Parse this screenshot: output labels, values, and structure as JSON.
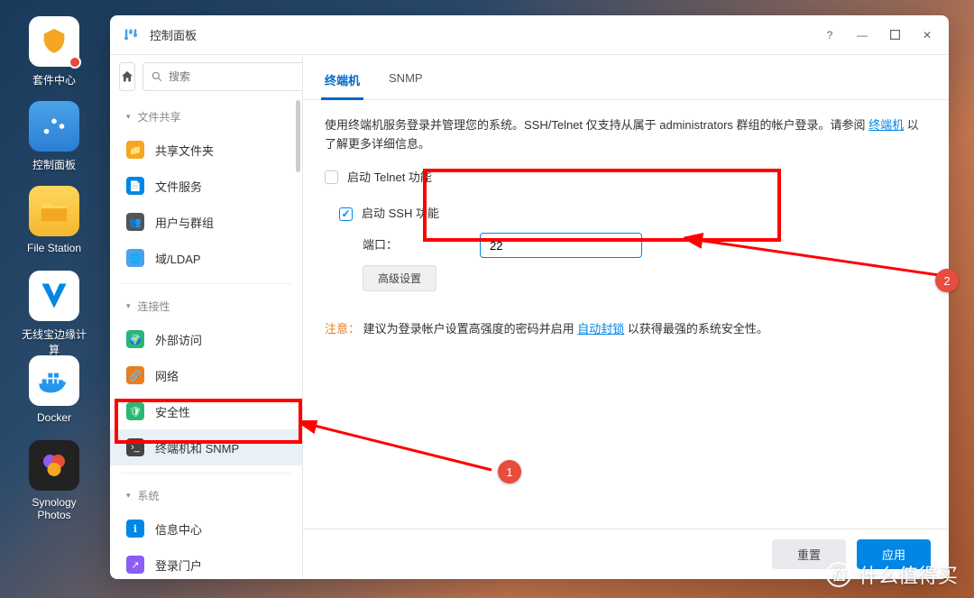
{
  "desktop": {
    "items": [
      {
        "label": "套件中心"
      },
      {
        "label": "控制面板"
      },
      {
        "label": "File Station"
      },
      {
        "label": "无线宝边缘计算"
      },
      {
        "label": "Docker"
      },
      {
        "label": "Synology Photos"
      }
    ]
  },
  "window": {
    "title": "控制面板",
    "search_placeholder": "搜索"
  },
  "sidebar": {
    "groups": [
      {
        "label": "文件共享",
        "items": [
          {
            "label": "共享文件夹"
          },
          {
            "label": "文件服务"
          },
          {
            "label": "用户与群组"
          },
          {
            "label": "域/LDAP"
          }
        ]
      },
      {
        "label": "连接性",
        "items": [
          {
            "label": "外部访问"
          },
          {
            "label": "网络"
          },
          {
            "label": "安全性"
          },
          {
            "label": "终端机和 SNMP"
          }
        ]
      },
      {
        "label": "系统",
        "items": [
          {
            "label": "信息中心"
          },
          {
            "label": "登录门户"
          }
        ]
      }
    ]
  },
  "main": {
    "tabs": [
      {
        "label": "终端机"
      },
      {
        "label": "SNMP"
      }
    ],
    "description_pre": "使用终端机服务登录并管理您的系统。SSH/Telnet 仅支持从属于 administrators 群组的帐户登录。请参阅 ",
    "description_link": "终端机",
    "description_post": " 以了解更多详细信息。",
    "telnet_label": "启动 Telnet 功能",
    "ssh_label": "启动 SSH 功能",
    "port_label": "端口：",
    "port_value": "22",
    "advanced_btn": "高级设置",
    "note_warn": "注意：",
    "note_pre": " 建议为登录帐户设置高强度的密码并启用 ",
    "note_link": "自动封锁",
    "note_post": " 以获得最强的系统安全性。",
    "reset_btn": "重置",
    "apply_btn": "应用"
  },
  "annotations": {
    "badge1": "1",
    "badge2": "2"
  },
  "watermark": {
    "icon": "值",
    "text": "什么值得买"
  }
}
